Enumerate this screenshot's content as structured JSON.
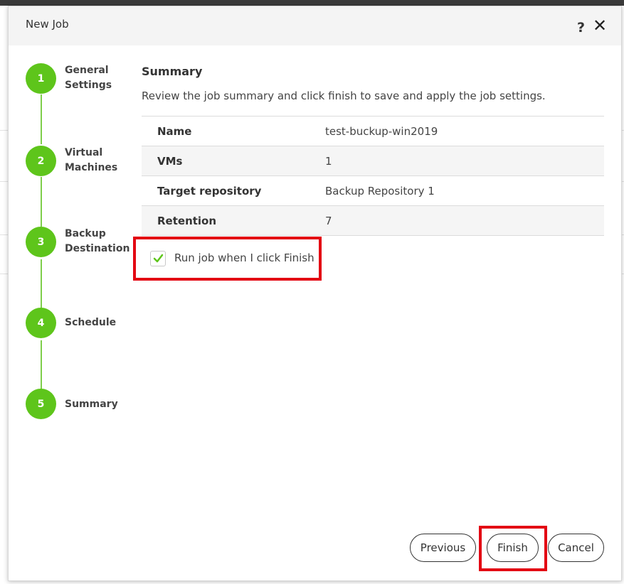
{
  "dialog": {
    "title": "New Job",
    "help_label": "?",
    "close_label": "✕"
  },
  "steps": [
    {
      "number": "1",
      "label": "General Settings"
    },
    {
      "number": "2",
      "label": "Virtual Machines"
    },
    {
      "number": "3",
      "label": "Backup Destination"
    },
    {
      "number": "4",
      "label": "Schedule"
    },
    {
      "number": "5",
      "label": "Summary"
    }
  ],
  "summary": {
    "title": "Summary",
    "description": "Review the job summary and click finish to save and apply the job settings.",
    "rows": [
      {
        "key": "Name",
        "value": "test-buckup-win2019"
      },
      {
        "key": "VMs",
        "value": "1"
      },
      {
        "key": "Target repository",
        "value": "Backup Repository 1"
      },
      {
        "key": "Retention",
        "value": "7"
      }
    ]
  },
  "run_option": {
    "label": "Run job when I click Finish",
    "checked": true
  },
  "buttons": {
    "previous": "Previous",
    "finish": "Finish",
    "cancel": "Cancel"
  },
  "colors": {
    "step_green": "#5ec51b",
    "highlight_red": "#e30613"
  }
}
